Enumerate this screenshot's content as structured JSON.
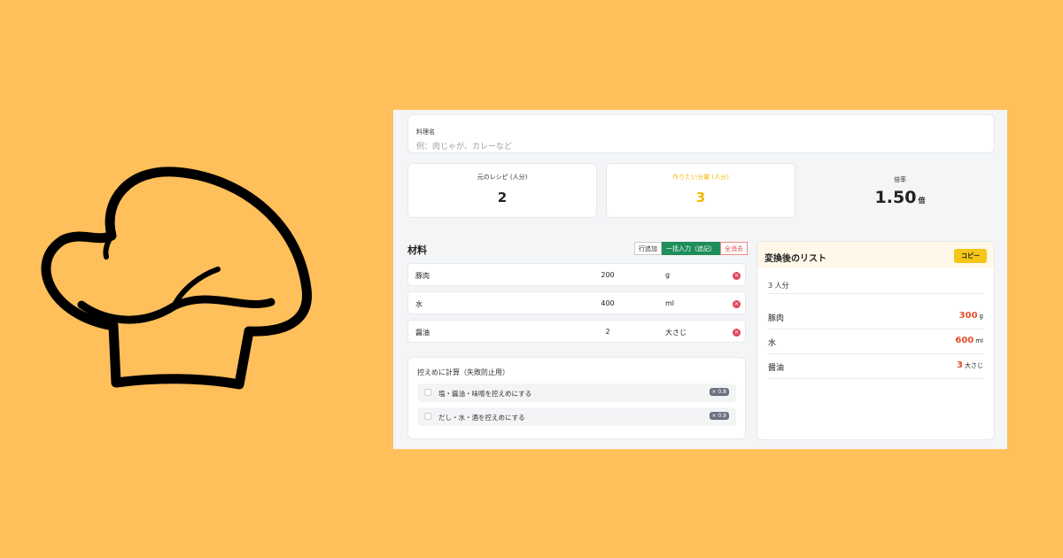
{
  "logo": {
    "icon": "chef-hat-icon"
  },
  "dish": {
    "label": "料理名",
    "placeholder": "例：肉じゃが、カレーなど"
  },
  "servings": {
    "original_label": "元のレシピ (人分)",
    "original_value": "2",
    "target_label": "作りたい分量 (人分)",
    "target_value": "3",
    "ratio_label": "倍率",
    "ratio_value": "1.50",
    "ratio_unit": "倍"
  },
  "ingredients": {
    "title": "材料",
    "buttons": {
      "add_row": "行追加",
      "bulk_input": "一括入力（追記）",
      "clear_all": "全消去"
    },
    "rows": [
      {
        "name": "豚肉",
        "amount": "200",
        "unit": "g"
      },
      {
        "name": "水",
        "amount": "400",
        "unit": "ml"
      },
      {
        "name": "醤油",
        "amount": "2",
        "unit": "大さじ"
      }
    ]
  },
  "reduce": {
    "label": "控えめに計算（失敗防止用）",
    "options": [
      {
        "text": "塩・醤油・味噌を控えめにする",
        "factor": "× 0.8",
        "checked": false
      },
      {
        "text": "だし・水・酒を控えめにする",
        "factor": "× 0.9",
        "checked": false
      }
    ]
  },
  "result": {
    "title": "変換後のリスト",
    "copy_label": "コピー",
    "servings": "3 人分",
    "rows": [
      {
        "name": "豚肉",
        "amount": "300",
        "unit": "g"
      },
      {
        "name": "水",
        "amount": "600",
        "unit": "ml"
      },
      {
        "name": "醤油",
        "amount": "3",
        "unit": "大さじ"
      }
    ]
  },
  "colors": {
    "background": "#FFBF5A",
    "accent_yellow": "#F2B705",
    "accent_green": "#1E8E5A",
    "result_orange": "#E0532B",
    "delete_red": "#E0445B"
  }
}
